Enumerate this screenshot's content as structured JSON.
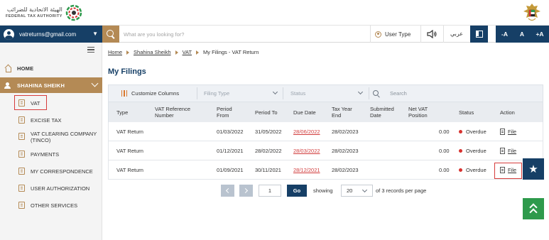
{
  "header": {
    "org_name_ar": "الهيئة الاتحادية للضرائب",
    "org_name_en": "FEDERAL TAX AUTHORITY"
  },
  "navbar": {
    "user_email": "vatreturns@gmail.com",
    "search_placeholder": "What are you looking for?",
    "user_type_label": "User Type",
    "language_label": "عربي",
    "font_decrease": "-A",
    "font_normal": "A",
    "font_increase": "+A"
  },
  "sidebar": {
    "home_label": "HOME",
    "group_label": "SHAHINA SHEIKH",
    "items": [
      {
        "label": "VAT"
      },
      {
        "label": "EXCISE TAX"
      },
      {
        "label": "VAT CLEARING COMPANY (TINCO)"
      },
      {
        "label": "PAYMENTS"
      },
      {
        "label": "MY CORRESPONDENCE"
      },
      {
        "label": "USER AUTHORIZATION"
      },
      {
        "label": "OTHER SERVICES"
      }
    ]
  },
  "breadcrumb": {
    "home": "Home",
    "user": "Shahina Sheikh",
    "section": "VAT",
    "current": "My Filings - VAT Return"
  },
  "page_title": "My Filings",
  "toolbar": {
    "customize_columns": "Customize Columns",
    "filing_type_placeholder": "Filing Type",
    "status_placeholder": "Status",
    "search_placeholder": "Search"
  },
  "table": {
    "headers": [
      "Type",
      "VAT Reference Number",
      "Period From",
      "Period To",
      "Due Date",
      "Tax Year End",
      "Submitted Date",
      "Net VAT Position",
      "Status",
      "Action"
    ],
    "rows": [
      {
        "type": "VAT Return",
        "vat_ref": "",
        "period_from": "01/03/2022",
        "period_to": "31/05/2022",
        "due_date": "28/06/2022",
        "tax_year_end": "28/02/2023",
        "submitted": "",
        "net_vat": "0.00",
        "status": "Overdue",
        "action": "File"
      },
      {
        "type": "VAT Return",
        "vat_ref": "",
        "period_from": "01/12/2021",
        "period_to": "28/02/2022",
        "due_date": "28/03/2022",
        "tax_year_end": "28/02/2023",
        "submitted": "",
        "net_vat": "0.00",
        "status": "Overdue",
        "action": "File"
      },
      {
        "type": "VAT Return",
        "vat_ref": "",
        "period_from": "01/09/2021",
        "period_to": "30/11/2021",
        "due_date": "28/12/2021",
        "tax_year_end": "28/02/2023",
        "submitted": "",
        "net_vat": "0.00",
        "status": "Overdue",
        "action": "File"
      }
    ]
  },
  "pagination": {
    "page": "1",
    "go_label": "Go",
    "showing_label": "showing",
    "per_page": "20",
    "records_label": "of 3 records per page"
  },
  "colors": {
    "primary": "#163f66",
    "accent_gold": "#b48a55",
    "overdue_red": "#d7322f",
    "success_green": "#2e9a4c"
  }
}
